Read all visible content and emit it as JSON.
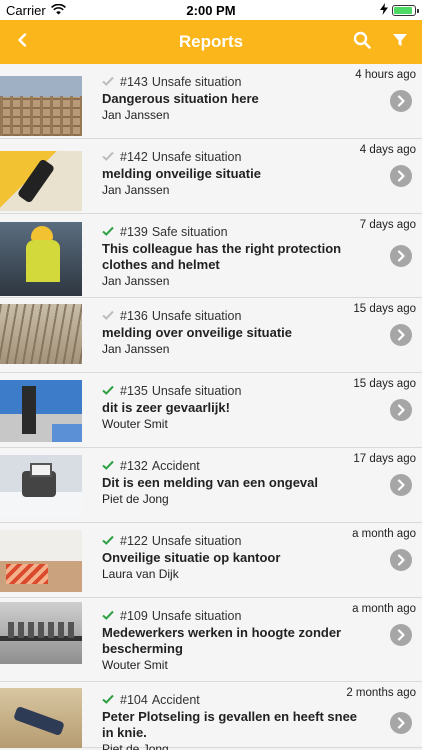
{
  "status_bar": {
    "carrier": "Carrier",
    "time": "2:00 PM",
    "battery_level": 0.92
  },
  "nav": {
    "title": "Reports",
    "back_icon": "chevron-left-icon",
    "search_icon": "search-icon",
    "filter_icon": "filter-icon"
  },
  "colors": {
    "nav_bg": "#fbb61b",
    "check_resolved": "#2ea043",
    "check_pending": "#bdbdbd",
    "chevron_bg": "#a6a6a6"
  },
  "reports": [
    {
      "id": "#143",
      "type": "Unsafe situation",
      "title": "Dangerous situation here",
      "author": "Jan Janssen",
      "time": "4 hours ago",
      "resolved": false
    },
    {
      "id": "#142",
      "type": "Unsafe situation",
      "title": "melding onveilige situatie",
      "author": "Jan Janssen",
      "time": "4 days ago",
      "resolved": false
    },
    {
      "id": "#139",
      "type": "Safe situation",
      "title": "This colleague has the right protection clothes and helmet",
      "author": "Jan Janssen",
      "time": "7 days ago",
      "resolved": true
    },
    {
      "id": "#136",
      "type": "Unsafe situation",
      "title": "melding over onveilige situatie",
      "author": "Jan Janssen",
      "time": "15 days ago",
      "resolved": false
    },
    {
      "id": "#135",
      "type": "Unsafe situation",
      "title": "dit is zeer gevaarlijk!",
      "author": "Wouter Smit",
      "time": "15 days ago",
      "resolved": true
    },
    {
      "id": "#132",
      "type": "Accident",
      "title": "Dit is een melding van een ongeval",
      "author": "Piet de Jong",
      "time": "17 days ago",
      "resolved": true
    },
    {
      "id": "#122",
      "type": "Unsafe situation",
      "title": "Onveilige situatie op kantoor",
      "author": "Laura van Dijk",
      "time": "a month ago",
      "resolved": true
    },
    {
      "id": "#109",
      "type": "Unsafe situation",
      "title": "Medewerkers werken in hoogte zonder bescherming",
      "author": "Wouter Smit",
      "time": "a month ago",
      "resolved": true
    },
    {
      "id": "#104",
      "type": "Accident",
      "title": "Peter Plotseling is gevallen en heeft snee in knie.",
      "author": "Piet de Jong",
      "time": "2 months ago",
      "resolved": true
    }
  ]
}
